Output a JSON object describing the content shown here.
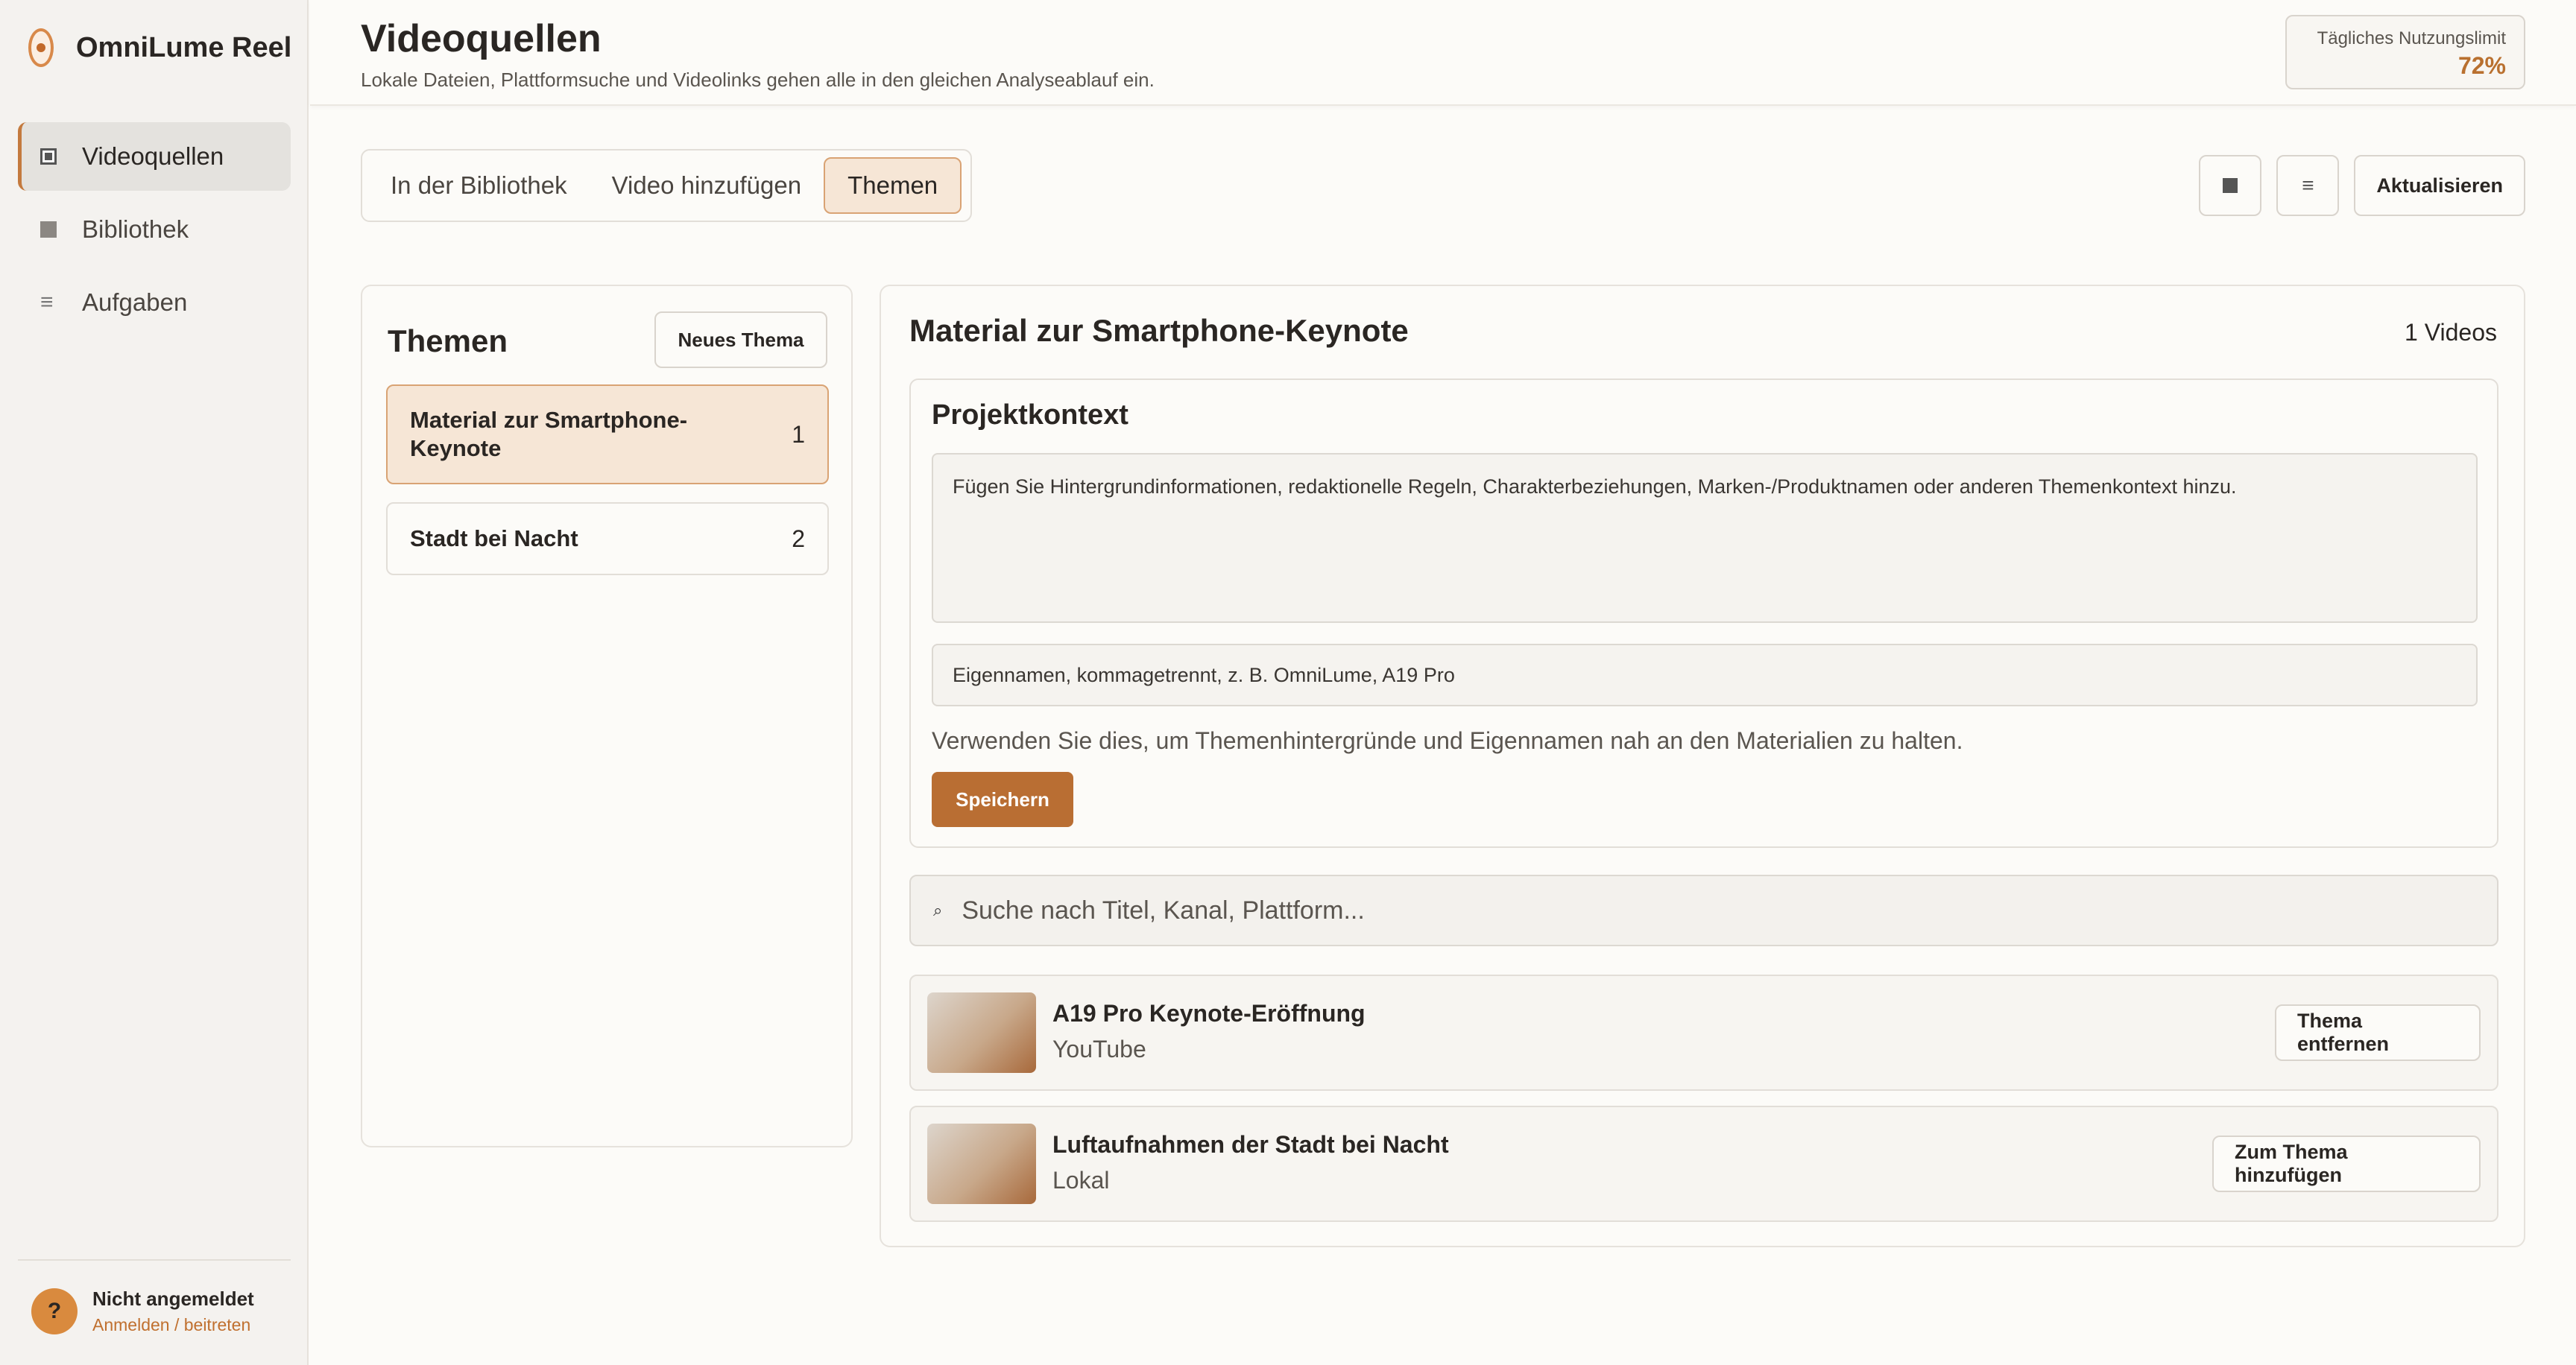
{
  "app": {
    "name": "OmniLume Reel"
  },
  "sidebar": {
    "items": [
      {
        "label": "Videoquellen",
        "active": true
      },
      {
        "label": "Bibliothek",
        "active": false
      },
      {
        "label": "Aufgaben",
        "active": false
      }
    ],
    "user": {
      "avatar": "?",
      "name": "Nicht angemeldet",
      "link": "Anmelden / beitreten"
    }
  },
  "header": {
    "title": "Videoquellen",
    "subtitle": "Lokale Dateien, Plattformsuche und Videolinks gehen alle in den gleichen Analyseablauf ein.",
    "usage_label": "Tägliches Nutzungslimit",
    "usage_value": "72%"
  },
  "tabs": [
    {
      "label": "In der Bibliothek",
      "active": false
    },
    {
      "label": "Video hinzufügen",
      "active": false
    },
    {
      "label": "Themen",
      "active": true
    }
  ],
  "toolbar": {
    "grid_icon": "square-icon",
    "list_icon": "list-icon",
    "refresh_label": "Aktualisieren"
  },
  "themes": {
    "title": "Themen",
    "new_button": "Neues Thema",
    "items": [
      {
        "name": "Material zur Smartphone-Keynote",
        "count": "1",
        "active": true
      },
      {
        "name": "Stadt bei Nacht",
        "count": "2",
        "active": false
      }
    ]
  },
  "detail": {
    "title": "Material zur Smartphone-Keynote",
    "video_count": "1 Videos",
    "context": {
      "title": "Projektkontext",
      "textarea_placeholder": "Fügen Sie Hintergrundinformationen, redaktionelle Regeln, Charakterbeziehungen, Marken-/Produktnamen oder anderen Themenkontext hinzu.",
      "names_placeholder": "Eigennamen, kommagetrennt, z. B. OmniLume, A19 Pro",
      "hint": "Verwenden Sie dies, um Themenhintergründe und Eigennamen nah an den Materialien zu halten.",
      "save_label": "Speichern"
    },
    "search_placeholder": "Suche nach Titel, Kanal, Plattform...",
    "videos": [
      {
        "title": "A19 Pro Keynote-Eröffnung",
        "source": "YouTube",
        "action": "Thema entfernen"
      },
      {
        "title": "Luftaufnahmen der Stadt bei Nacht",
        "source": "Lokal",
        "action": "Zum Thema hinzufügen"
      }
    ]
  },
  "colors": {
    "accent": "#b96e33",
    "accent_light": "#f6e6d6",
    "background": "#fcfbf8",
    "sidebar": "#f4f2ef"
  }
}
